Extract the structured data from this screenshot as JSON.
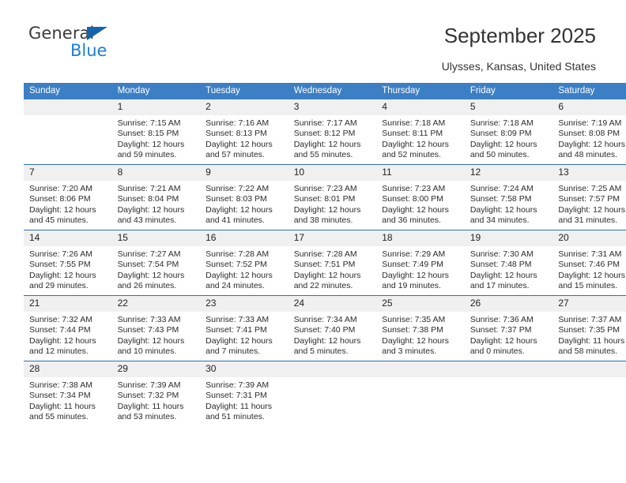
{
  "brand": {
    "name_top": "General",
    "name_bottom": "Blue",
    "triangle_color": "#1464ac",
    "blue_color": "#1b7fd4"
  },
  "header": {
    "title": "September 2025",
    "location": "Ulysses, Kansas, United States"
  },
  "calendar": {
    "header_bg": "#3c7fc4",
    "daynum_bg": "#f0f0f0",
    "row_divider": "#2f6fb0",
    "weekday_headers": [
      "Sunday",
      "Monday",
      "Tuesday",
      "Wednesday",
      "Thursday",
      "Friday",
      "Saturday"
    ],
    "weeks": [
      [
        {
          "day": "",
          "lines": []
        },
        {
          "day": "1",
          "lines": [
            "Sunrise: 7:15 AM",
            "Sunset: 8:15 PM",
            "Daylight: 12 hours",
            "and 59 minutes."
          ]
        },
        {
          "day": "2",
          "lines": [
            "Sunrise: 7:16 AM",
            "Sunset: 8:13 PM",
            "Daylight: 12 hours",
            "and 57 minutes."
          ]
        },
        {
          "day": "3",
          "lines": [
            "Sunrise: 7:17 AM",
            "Sunset: 8:12 PM",
            "Daylight: 12 hours",
            "and 55 minutes."
          ]
        },
        {
          "day": "4",
          "lines": [
            "Sunrise: 7:18 AM",
            "Sunset: 8:11 PM",
            "Daylight: 12 hours",
            "and 52 minutes."
          ]
        },
        {
          "day": "5",
          "lines": [
            "Sunrise: 7:18 AM",
            "Sunset: 8:09 PM",
            "Daylight: 12 hours",
            "and 50 minutes."
          ]
        },
        {
          "day": "6",
          "lines": [
            "Sunrise: 7:19 AM",
            "Sunset: 8:08 PM",
            "Daylight: 12 hours",
            "and 48 minutes."
          ]
        }
      ],
      [
        {
          "day": "7",
          "lines": [
            "Sunrise: 7:20 AM",
            "Sunset: 8:06 PM",
            "Daylight: 12 hours",
            "and 45 minutes."
          ]
        },
        {
          "day": "8",
          "lines": [
            "Sunrise: 7:21 AM",
            "Sunset: 8:04 PM",
            "Daylight: 12 hours",
            "and 43 minutes."
          ]
        },
        {
          "day": "9",
          "lines": [
            "Sunrise: 7:22 AM",
            "Sunset: 8:03 PM",
            "Daylight: 12 hours",
            "and 41 minutes."
          ]
        },
        {
          "day": "10",
          "lines": [
            "Sunrise: 7:23 AM",
            "Sunset: 8:01 PM",
            "Daylight: 12 hours",
            "and 38 minutes."
          ]
        },
        {
          "day": "11",
          "lines": [
            "Sunrise: 7:23 AM",
            "Sunset: 8:00 PM",
            "Daylight: 12 hours",
            "and 36 minutes."
          ]
        },
        {
          "day": "12",
          "lines": [
            "Sunrise: 7:24 AM",
            "Sunset: 7:58 PM",
            "Daylight: 12 hours",
            "and 34 minutes."
          ]
        },
        {
          "day": "13",
          "lines": [
            "Sunrise: 7:25 AM",
            "Sunset: 7:57 PM",
            "Daylight: 12 hours",
            "and 31 minutes."
          ]
        }
      ],
      [
        {
          "day": "14",
          "lines": [
            "Sunrise: 7:26 AM",
            "Sunset: 7:55 PM",
            "Daylight: 12 hours",
            "and 29 minutes."
          ]
        },
        {
          "day": "15",
          "lines": [
            "Sunrise: 7:27 AM",
            "Sunset: 7:54 PM",
            "Daylight: 12 hours",
            "and 26 minutes."
          ]
        },
        {
          "day": "16",
          "lines": [
            "Sunrise: 7:28 AM",
            "Sunset: 7:52 PM",
            "Daylight: 12 hours",
            "and 24 minutes."
          ]
        },
        {
          "day": "17",
          "lines": [
            "Sunrise: 7:28 AM",
            "Sunset: 7:51 PM",
            "Daylight: 12 hours",
            "and 22 minutes."
          ]
        },
        {
          "day": "18",
          "lines": [
            "Sunrise: 7:29 AM",
            "Sunset: 7:49 PM",
            "Daylight: 12 hours",
            "and 19 minutes."
          ]
        },
        {
          "day": "19",
          "lines": [
            "Sunrise: 7:30 AM",
            "Sunset: 7:48 PM",
            "Daylight: 12 hours",
            "and 17 minutes."
          ]
        },
        {
          "day": "20",
          "lines": [
            "Sunrise: 7:31 AM",
            "Sunset: 7:46 PM",
            "Daylight: 12 hours",
            "and 15 minutes."
          ]
        }
      ],
      [
        {
          "day": "21",
          "lines": [
            "Sunrise: 7:32 AM",
            "Sunset: 7:44 PM",
            "Daylight: 12 hours",
            "and 12 minutes."
          ]
        },
        {
          "day": "22",
          "lines": [
            "Sunrise: 7:33 AM",
            "Sunset: 7:43 PM",
            "Daylight: 12 hours",
            "and 10 minutes."
          ]
        },
        {
          "day": "23",
          "lines": [
            "Sunrise: 7:33 AM",
            "Sunset: 7:41 PM",
            "Daylight: 12 hours",
            "and 7 minutes."
          ]
        },
        {
          "day": "24",
          "lines": [
            "Sunrise: 7:34 AM",
            "Sunset: 7:40 PM",
            "Daylight: 12 hours",
            "and 5 minutes."
          ]
        },
        {
          "day": "25",
          "lines": [
            "Sunrise: 7:35 AM",
            "Sunset: 7:38 PM",
            "Daylight: 12 hours",
            "and 3 minutes."
          ]
        },
        {
          "day": "26",
          "lines": [
            "Sunrise: 7:36 AM",
            "Sunset: 7:37 PM",
            "Daylight: 12 hours",
            "and 0 minutes."
          ]
        },
        {
          "day": "27",
          "lines": [
            "Sunrise: 7:37 AM",
            "Sunset: 7:35 PM",
            "Daylight: 11 hours",
            "and 58 minutes."
          ]
        }
      ],
      [
        {
          "day": "28",
          "lines": [
            "Sunrise: 7:38 AM",
            "Sunset: 7:34 PM",
            "Daylight: 11 hours",
            "and 55 minutes."
          ]
        },
        {
          "day": "29",
          "lines": [
            "Sunrise: 7:39 AM",
            "Sunset: 7:32 PM",
            "Daylight: 11 hours",
            "and 53 minutes."
          ]
        },
        {
          "day": "30",
          "lines": [
            "Sunrise: 7:39 AM",
            "Sunset: 7:31 PM",
            "Daylight: 11 hours",
            "and 51 minutes."
          ]
        },
        {
          "day": "",
          "lines": []
        },
        {
          "day": "",
          "lines": []
        },
        {
          "day": "",
          "lines": []
        },
        {
          "day": "",
          "lines": []
        }
      ]
    ]
  }
}
